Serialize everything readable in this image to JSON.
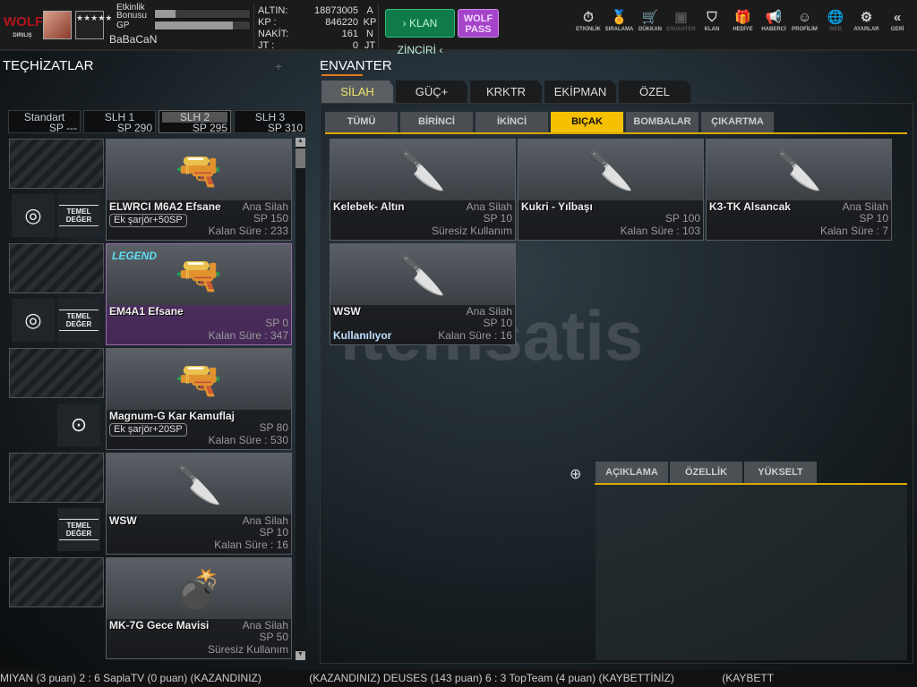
{
  "header": {
    "logo": "WOLF",
    "logo_sub": "DIRILIŞ",
    "rank_icon": "★★★★★",
    "event_bonus_label": "Etkinlik Bonusu",
    "event_bonus_pct": 22,
    "gp_label": "GP",
    "gp_pct": 82,
    "username": "BaBaCaN",
    "currency": [
      {
        "label": "ALTIN:",
        "value": "18873005",
        "unit": "A"
      },
      {
        "label": "KP :",
        "value": "846220",
        "unit": "KP"
      },
      {
        "label": "NAKİT:",
        "value": "161",
        "unit": "N"
      },
      {
        "label": "JT :",
        "value": "0",
        "unit": "JT"
      }
    ],
    "klan_button": "› KLAN ZİNCİRİ ‹",
    "wolf_button": "WOLF PASS",
    "nav": [
      {
        "label": "ETKİNLİK",
        "icon": "⏱"
      },
      {
        "label": "SIRALAMA",
        "icon": "🏅"
      },
      {
        "label": "DÜKKAN",
        "icon": "🛒"
      },
      {
        "label": "ENVANTER",
        "icon": "▣"
      },
      {
        "label": "KLAN",
        "icon": "⛉"
      },
      {
        "label": "HEDİYE",
        "icon": "🎁"
      },
      {
        "label": "HABERCİ",
        "icon": "📢"
      },
      {
        "label": "PROFİLİM",
        "icon": "☺"
      },
      {
        "label": "WEB",
        "icon": "🌐"
      },
      {
        "label": "AYARLAR",
        "icon": "⚙"
      },
      {
        "label": "GERİ",
        "icon": "«"
      }
    ]
  },
  "left": {
    "title": "TEÇHİZATLAR",
    "loadouts": [
      {
        "name": "Standart",
        "sp": "SP ---"
      },
      {
        "name": "SLH 1",
        "sp": "SP 290"
      },
      {
        "name": "SLH 2",
        "sp": "SP 295"
      },
      {
        "name": "SLH 3",
        "sp": "SP 310"
      }
    ],
    "temel_line1": "TEMEL",
    "temel_line2": "DEĞER",
    "slots": [
      {
        "name": "ELWRCI M6A2 Efsane",
        "type": "Ana Silah",
        "sp": "SP 150",
        "time": "Kalan Süre : 233",
        "extra": "Ek şarjör+50SP",
        "icon": "🔫"
      },
      {
        "name": "EM4A1 Efsane",
        "type": "",
        "sp": "SP 0",
        "time": "Kalan Süre : 347",
        "extra": "",
        "badge": "LEGEND",
        "icon": "🔫"
      },
      {
        "name": "Magnum-G Kar Kamuflaj",
        "type": "",
        "sp": "SP 80",
        "time": "Kalan Süre : 530",
        "extra": "Ek şarjör+20SP",
        "icon": "🔫"
      },
      {
        "name": "WSW",
        "type": "Ana Silah",
        "sp": "SP 10",
        "time": "Kalan Süre : 16",
        "extra": "",
        "icon": "🔪"
      },
      {
        "name": "MK-7G Gece Mavisi",
        "type": "Ana Silah",
        "sp": "SP 50",
        "time": "Süresiz Kullanım",
        "extra": "",
        "icon": "💣"
      }
    ]
  },
  "inventory": {
    "title": "ENVANTER",
    "tabs": [
      "SİLAH",
      "GÜÇ+",
      "KRKTR",
      "EKİPMAN",
      "ÖZEL"
    ],
    "subtabs": [
      "TÜMÜ",
      "BİRİNCİ",
      "İKİNCİ",
      "BIÇAK",
      "BOMBALAR",
      "ÇIKARTMA"
    ],
    "items": [
      {
        "name": "Kelebek- Altın",
        "type": "Ana Silah",
        "sp": "SP 10",
        "time": "Süresiz Kullanım",
        "status": "",
        "icon": "🔪"
      },
      {
        "name": "Kukri - Yılbaşı",
        "type": "",
        "sp": "SP 100",
        "time": "Kalan Süre : 103",
        "status": "",
        "icon": "🔪"
      },
      {
        "name": "K3-TK Alsancak",
        "type": "Ana Silah",
        "sp": "SP 10",
        "time": "Kalan Süre : 7",
        "status": "",
        "icon": "🔪"
      },
      {
        "name": "WSW",
        "type": "Ana Silah",
        "sp": "SP 10",
        "time": "Kalan Süre : 16",
        "status": "Kullanılıyor",
        "icon": "🔪"
      }
    ]
  },
  "detail": {
    "tabs": [
      "AÇIKLAMA",
      "ÖZELLİK",
      "YÜKSELT"
    ]
  },
  "watermark": "itemsatis",
  "ticker": [
    "MIYAN (3 puan) 2 : 6 SaplaTV (0 puan) (KAZANDINIZ)",
    "(KAZANDINIZ) DEUSES (143 puan) 6 : 3 TopTeam (4 puan) (KAYBETTİNİZ)",
    "(KAYBETT"
  ],
  "colors": {
    "accent": "#f5c000",
    "klan": "#0f7a4a",
    "wolf": "#a544c9"
  }
}
